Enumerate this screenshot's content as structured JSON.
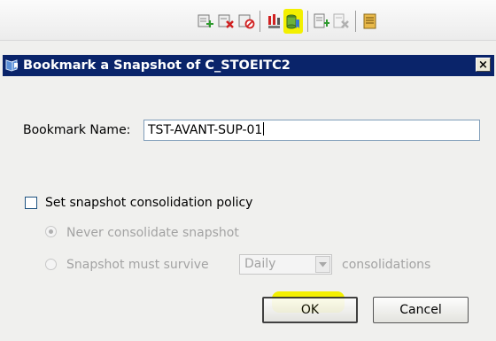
{
  "toolbar": {
    "icons": [
      "add-snapshot-icon",
      "delete-snapshot-icon",
      "cancel-snapshot-icon",
      "snapshot-report-icon",
      "bookmark-snapshot-icon",
      "add-bookmark-icon",
      "remove-bookmark-icon",
      "properties-icon"
    ]
  },
  "dialog": {
    "title": "Bookmark a Snapshot of  C_STOEITC2",
    "close_label": "×",
    "bookmark_name_label": "Bookmark Name:",
    "bookmark_name_value": "TST-AVANT-SUP-01",
    "consolidation_checkbox_label": "Set snapshot consolidation policy",
    "never_consolidate_label": "Never consolidate snapshot",
    "must_survive_label": "Snapshot must survive",
    "frequency_selected": "Daily",
    "consolidations_label": "consolidations",
    "ok_label": "OK",
    "cancel_label": "Cancel"
  },
  "state": {
    "consolidation_policy_checked": false,
    "never_consolidate_selected": true,
    "controls_disabled": true
  },
  "colors": {
    "titlebar": "#0a246a",
    "highlight": "#f3f000",
    "disabled_text": "#a3a3a3"
  }
}
